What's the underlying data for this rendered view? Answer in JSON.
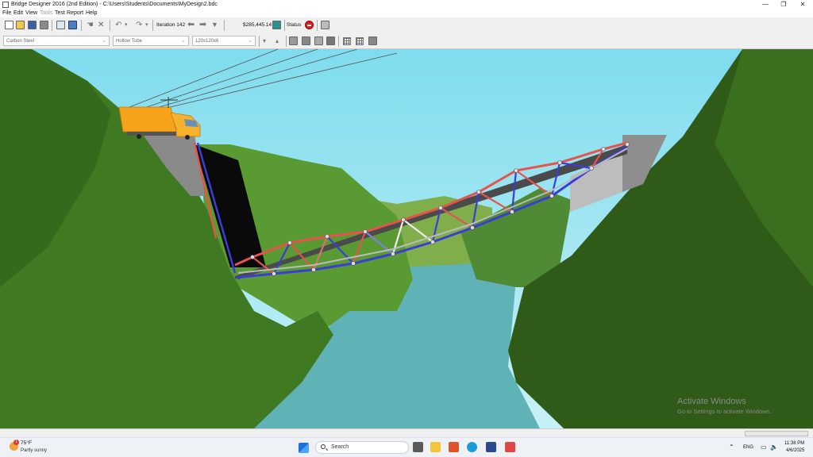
{
  "window": {
    "title": "Bridge Designer 2016 (2nd Edition) - C:\\Users\\Students\\Documents\\MyDesign2.bdc",
    "minimize_glyph": "—",
    "maximize_glyph": "❐",
    "close_glyph": "✕"
  },
  "menu": [
    "File",
    "Edit",
    "View",
    "Tools",
    "Test",
    "Report",
    "Help"
  ],
  "toolbar": {
    "iteration_label": "Iteration 142",
    "cost": "$285,445.14",
    "status_label": "Status"
  },
  "toolbar2": {
    "material": "Carbon Steel",
    "section": "Hollow Tube",
    "size": "120x120x6"
  },
  "watermark": {
    "title": "Activate Windows",
    "subtitle": "Go to Settings to activate Windows."
  },
  "taskbar": {
    "weather_temp": "75°F",
    "weather_desc": "Partly sunny",
    "weather_badge": "1",
    "search_placeholder": "Search",
    "language": "ENG",
    "time": "11:38 PM",
    "date": "4/6/2025"
  },
  "colors": {
    "tension": "#e8524d",
    "compression": "#3c3cd6",
    "sky": "#8ee1f0",
    "water": "#5fb3b7",
    "hill": "#4a8a2a",
    "truck": "#f7a21b"
  }
}
